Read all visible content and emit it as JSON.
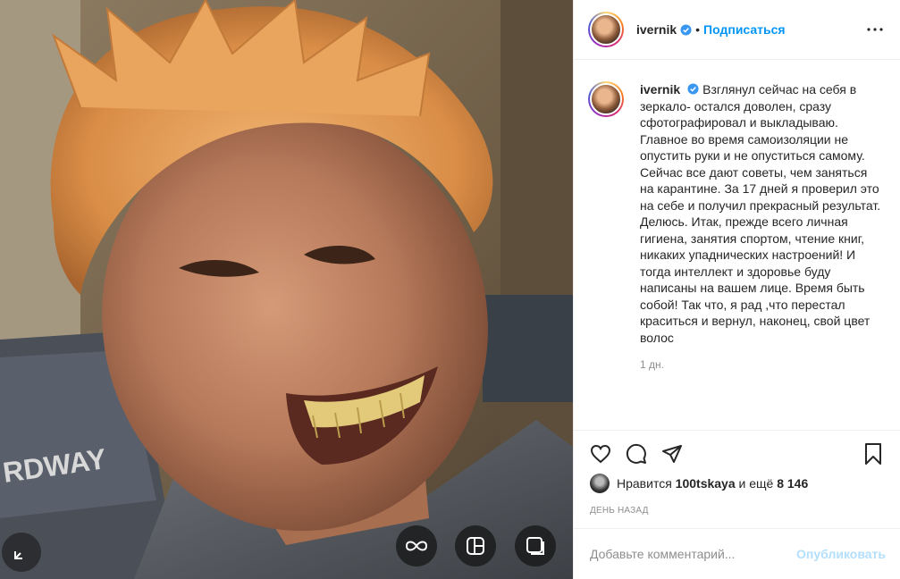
{
  "post": {
    "author": {
      "username": "ivernik",
      "verified": true,
      "follow_label": "Подписаться",
      "separator": "•"
    },
    "caption": "Взглянул сейчас на себя в зеркало- остался доволен, сразу сфотографировал и выкладываю. Главное во время самоизоляции не опустить руки и не опуститься самому. Сейчас все дают советы, чем заняться на карантине. За 17 дней я проверил это на себе и получил прекрасный результат. Делюсь. Итак, прежде всего личная гигиена, занятия спортом, чтение книг, никаких упаднических настроений! И тогда интеллект и здоровье буду написаны на вашем лице. Время быть собой! Так что, я рад ,что перестал краситься и вернул, наконец, свой цвет волос",
    "caption_time": "1 дн.",
    "likes": {
      "prefix": "Нравится",
      "user": "100tskaya",
      "middle": "и ещё",
      "count": "8 146"
    },
    "date": "ДЕНЬ НАЗАД",
    "comment_placeholder": "Добавьте комментарий...",
    "publish_label": "Опубликовать"
  },
  "icons": {
    "more": "more-horizontal-icon",
    "like": "heart-icon",
    "comment": "comment-icon",
    "share": "paper-plane-icon",
    "save": "bookmark-icon",
    "expand": "expand-icon",
    "boomerang": "infinity-icon",
    "layout": "layout-icon",
    "gallery": "gallery-icon"
  },
  "colors": {
    "link": "#0095f6",
    "muted": "#8e8e8e",
    "publish_disabled": "#b2dffc",
    "border": "#efefef",
    "verified": "#3897f0"
  }
}
